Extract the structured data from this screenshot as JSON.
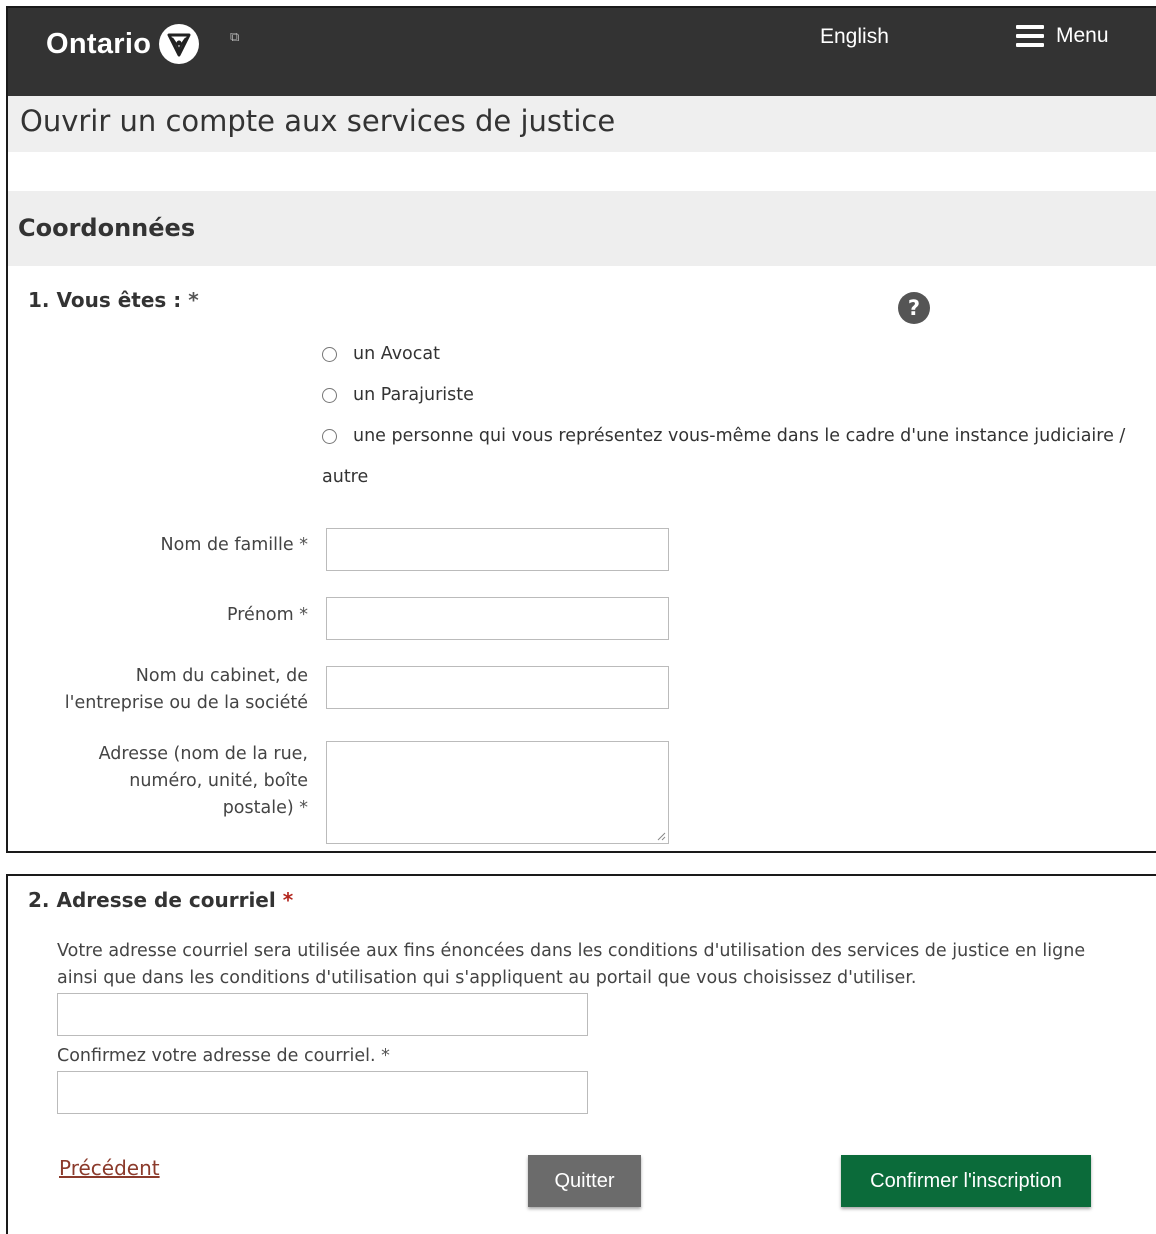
{
  "header": {
    "brand": "Ontario",
    "logo_icon": "trillium-icon",
    "language_link": "English",
    "menu_label": "Menu",
    "bg_color": "#333333"
  },
  "page_title": "Ouvrir un compte aux services de justice",
  "section_title": "Coordonnées",
  "question1": {
    "label": "1. Vous êtes :",
    "required_marker": "*",
    "options": [
      {
        "label": "un Avocat",
        "selected": false
      },
      {
        "label": "un Parajuriste",
        "selected": false
      },
      {
        "label": "une personne qui vous représentez vous-même dans le cadre d'une instance judiciaire /",
        "continuation": "autre",
        "selected": false
      }
    ]
  },
  "fields": {
    "last_name": {
      "label": "Nom de famille",
      "required": "*",
      "value": ""
    },
    "first_name": {
      "label": "Prénom",
      "required": "*",
      "value": ""
    },
    "company": {
      "label_line1": "Nom du cabinet, de",
      "label_line2": "l'entreprise ou de la société",
      "value": ""
    },
    "address": {
      "label_line1": "Adresse (nom de la rue,",
      "label_line2": "numéro, unité, boîte",
      "label_line3": "postale)",
      "required": "*",
      "value": ""
    }
  },
  "question2": {
    "label": "2. Adresse de courriel",
    "required_marker": "*",
    "description": "Votre adresse courriel sera utilisée aux fins énoncées dans les conditions d'utilisation des services de justice en ligne ainsi que dans les conditions d'utilisation qui s'appliquent au portail que vous choisissez d'utiliser.",
    "email_value": "",
    "confirm_label": "Confirmez votre adresse de courriel.",
    "confirm_required": "*",
    "confirm_value": ""
  },
  "actions": {
    "previous": "Précédent",
    "quit": "Quitter",
    "confirm": "Confirmer l'inscription",
    "confirm_color": "#0b6b3a",
    "quit_color": "#6b6b6b"
  }
}
